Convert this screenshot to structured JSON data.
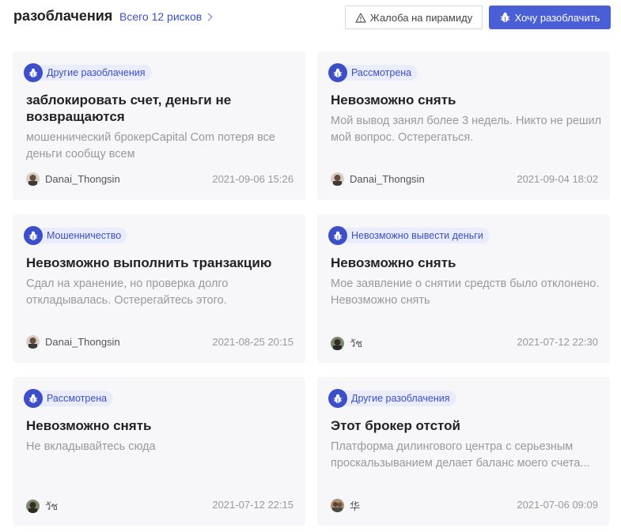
{
  "header": {
    "title": "разоблачения",
    "total_label": "Всего 12 рисков",
    "complaint_label": "Жалоба на пирамиду",
    "expose_label": "Хочу разоблачить",
    "accent_color": "#4a5fd6"
  },
  "cards": [
    {
      "tag": "Другие разоблачения",
      "title": "заблокировать счет, деньги не возвращаются",
      "description": "мошеннический брокерCapital Com потеря все деньги сообщу всем",
      "author": "Danai_Thongsin",
      "date": "2021-09-06 15:26"
    },
    {
      "tag": "Рассмотрена",
      "title": "Невозможно снять",
      "description": "Мой вывод занял более 3 недель. Никто не решил мой вопрос. Остерегаться.",
      "author": "Danai_Thongsin",
      "date": "2021-09-04 18:02"
    },
    {
      "tag": "Мошенничество",
      "title": "Невозможно выполнить транзакцию",
      "description": "Сдал на хранение, но проверка долго откладывалась. Остерегайтесь этого.",
      "author": "Danai_Thongsin",
      "date": "2021-08-25 20:15"
    },
    {
      "tag": "Невозможно вывести деньги",
      "title": "Невозможно снять",
      "description": "Мое заявление о снятии средств было отклонено. Невозможно снять",
      "author": "วัช",
      "date": "2021-07-12 22:30"
    },
    {
      "tag": "Рассмотрена",
      "title": "Невозможно снять",
      "description": "Не вкладывайтесь сюда",
      "author": "วัช",
      "date": "2021-07-12 22:15"
    },
    {
      "tag": "Другие разоблачения",
      "title": "Этот брокер отстой",
      "description": "Платформа дилингового центра с серьезным проскальзыванием делает баланс моего счета...",
      "author": "华",
      "date": "2021-07-06 09:09"
    }
  ]
}
